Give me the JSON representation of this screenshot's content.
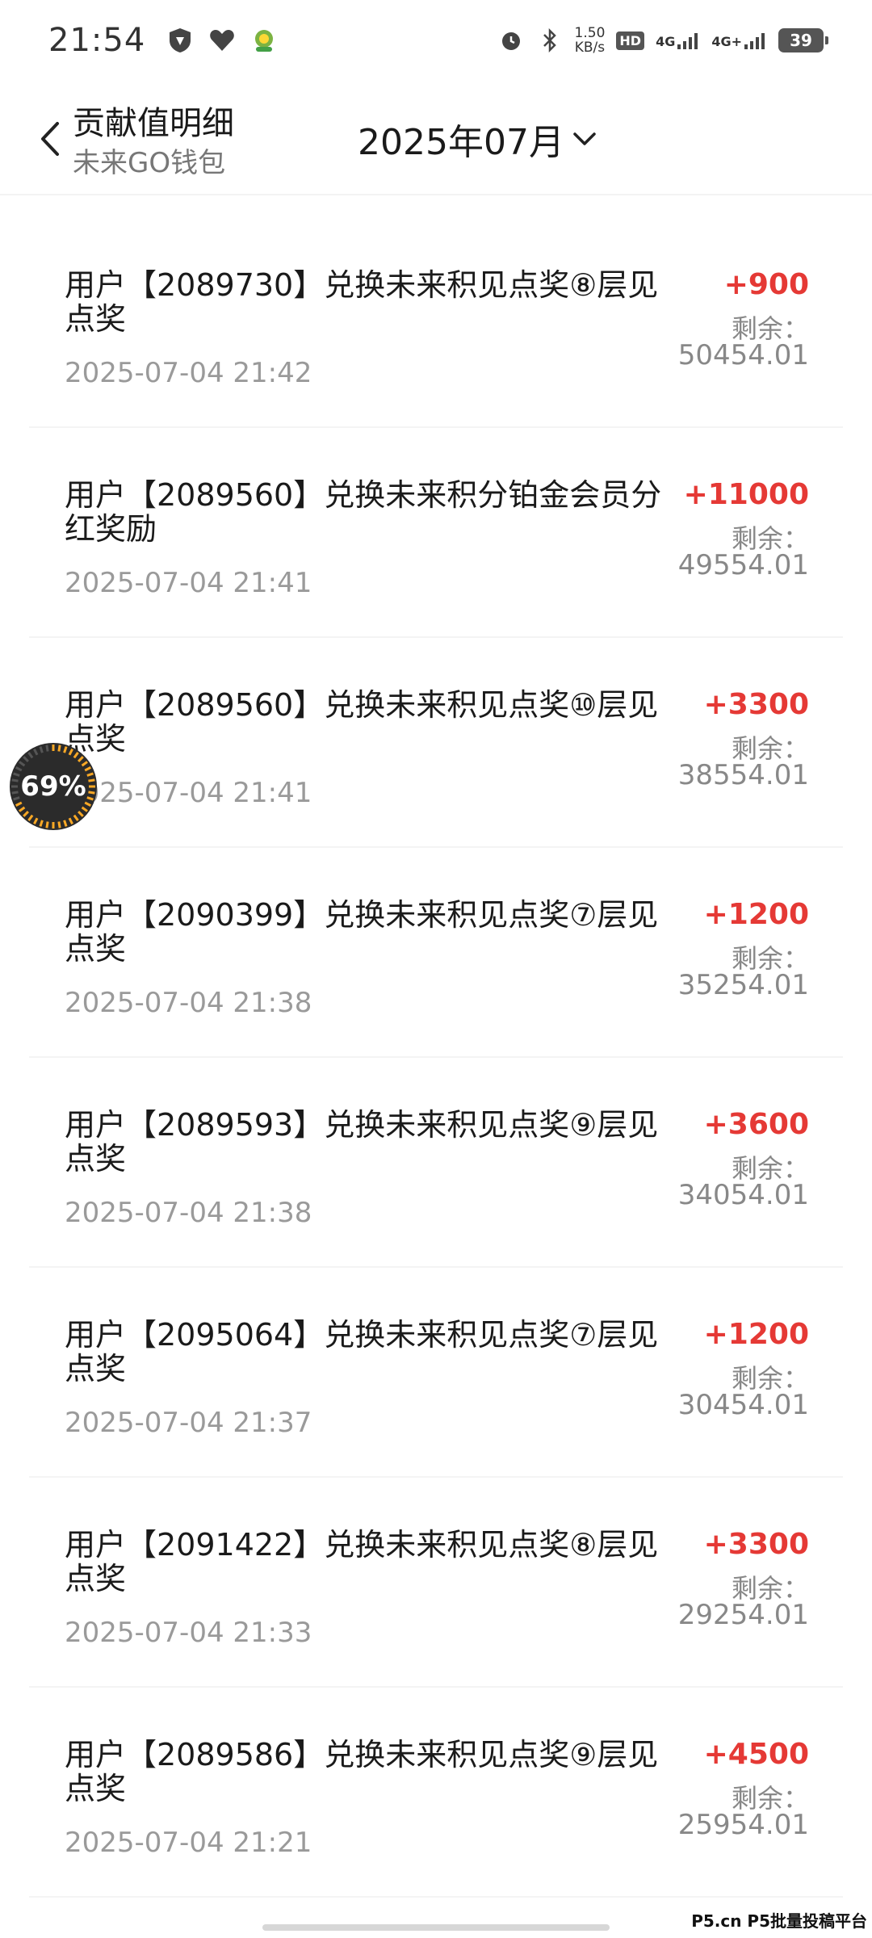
{
  "status_bar": {
    "time": "21:54",
    "net_speed_top": "1.50",
    "net_speed_bottom": "KB/s",
    "hd_label": "HD",
    "sim1_label": "4G",
    "sim2_label": "4G+",
    "battery_level": "39",
    "icons": [
      "shield-app-icon",
      "heart-app-icon",
      "cartoon-app-icon",
      "alarm-icon",
      "bluetooth-icon",
      "signal-icon",
      "battery-icon"
    ]
  },
  "header": {
    "title": "贡献值明细",
    "subtitle": "未来GO钱包",
    "month": "2025年07月"
  },
  "transactions": [
    {
      "desc": "用户【2089730】兑换未来积见点奖⑧层见点奖",
      "time": "2025-07-04 21:42",
      "amount": "+900",
      "remain_label": "剩余：",
      "remain": "50454.01"
    },
    {
      "desc": "用户【2089560】兑换未来积分铂金会员分红奖励",
      "time": "2025-07-04 21:41",
      "amount": "+11000",
      "remain_label": "剩余：",
      "remain": "49554.01"
    },
    {
      "desc": "用户【2089560】兑换未来积见点奖⑩层见点奖",
      "time": "2025-07-04 21:41",
      "amount": "+3300",
      "remain_label": "剩余：",
      "remain": "38554.01"
    },
    {
      "desc": "用户【2090399】兑换未来积见点奖⑦层见点奖",
      "time": "2025-07-04 21:38",
      "amount": "+1200",
      "remain_label": "剩余：",
      "remain": "35254.01"
    },
    {
      "desc": "用户【2089593】兑换未来积见点奖⑨层见点奖",
      "time": "2025-07-04 21:38",
      "amount": "+3600",
      "remain_label": "剩余：",
      "remain": "34054.01"
    },
    {
      "desc": "用户【2095064】兑换未来积见点奖⑦层见点奖",
      "time": "2025-07-04 21:37",
      "amount": "+1200",
      "remain_label": "剩余：",
      "remain": "30454.01"
    },
    {
      "desc": "用户【2091422】兑换未来积见点奖⑧层见点奖",
      "time": "2025-07-04 21:33",
      "amount": "+3300",
      "remain_label": "剩余：",
      "remain": "29254.01"
    },
    {
      "desc": "用户【2089586】兑换未来积见点奖⑨层见点奖",
      "time": "2025-07-04 21:21",
      "amount": "+4500",
      "remain_label": "剩余：",
      "remain": "25954.01"
    }
  ],
  "overlay": {
    "progress_text": "69%",
    "progress_fraction": 0.69
  },
  "watermark": "P5.cn P5批量投稿平台",
  "colors": {
    "amount": "#e53935",
    "muted": "#888888",
    "text": "#1a1a1a"
  }
}
